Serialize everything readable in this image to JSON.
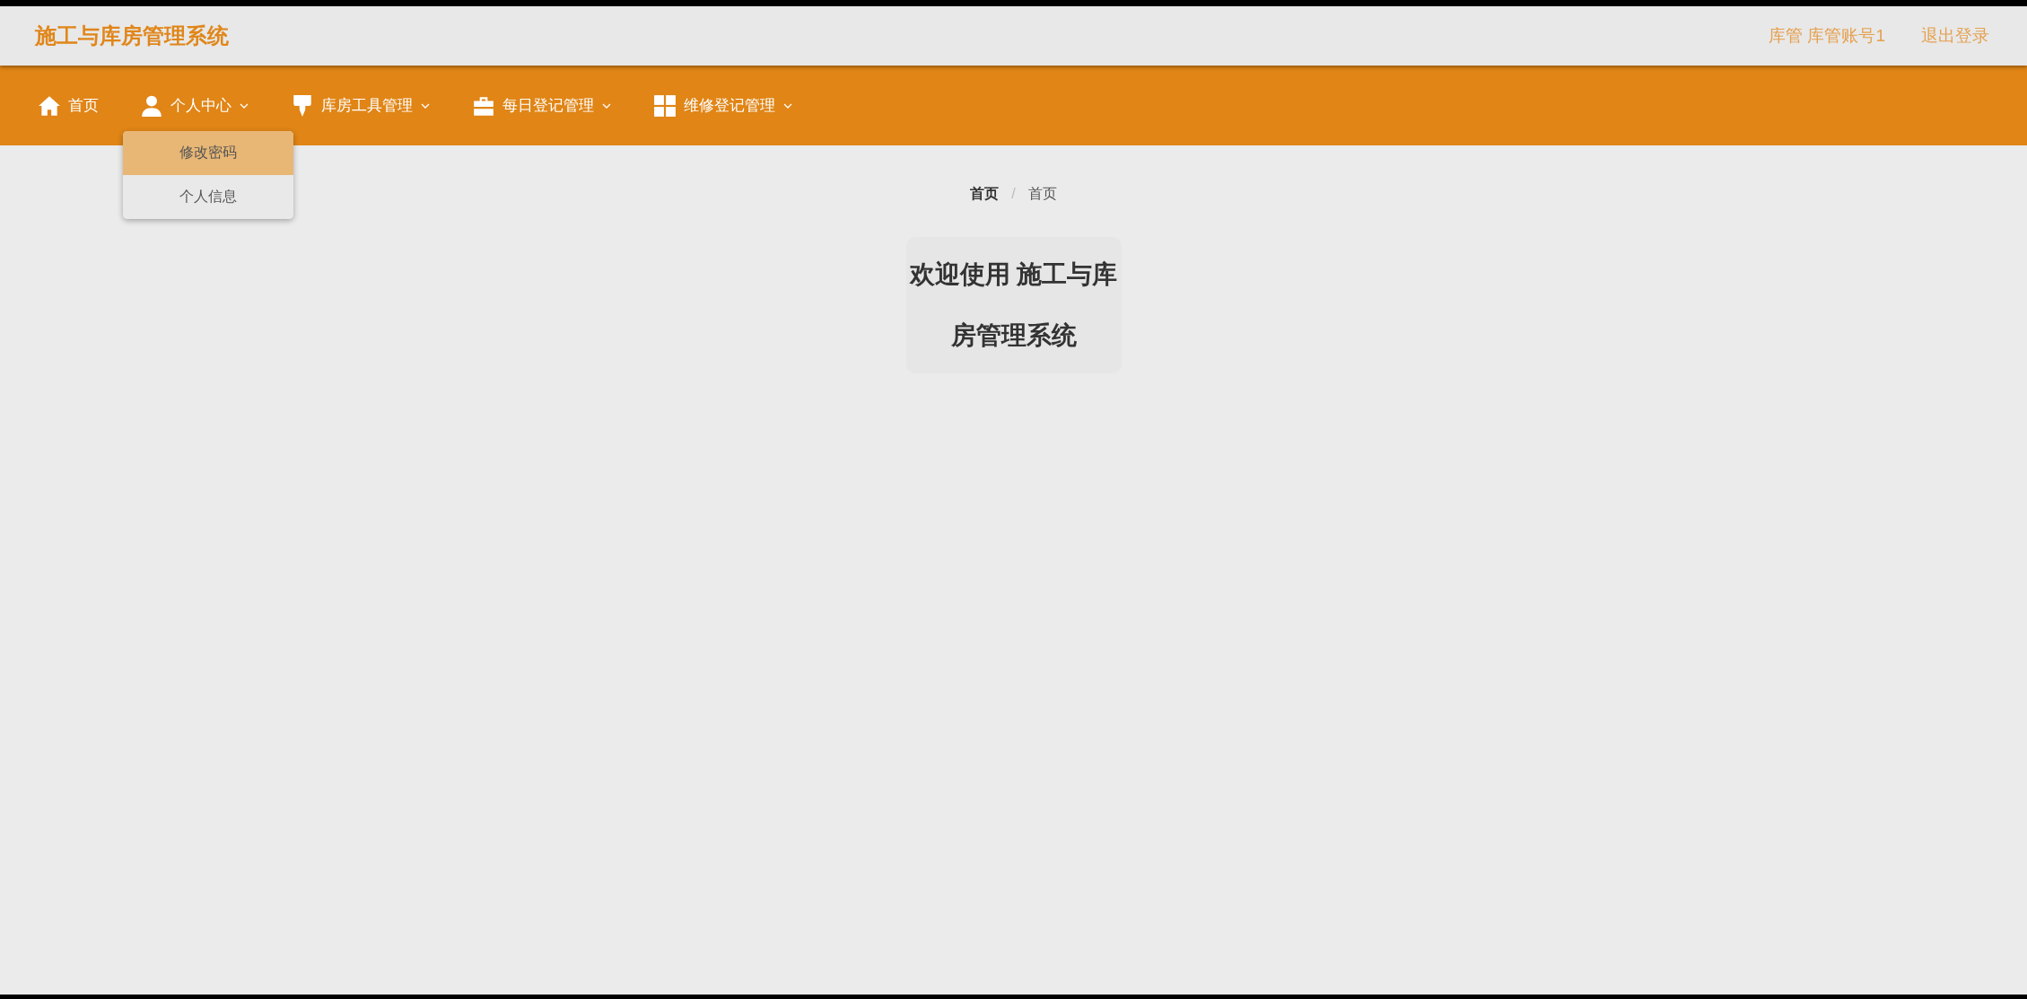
{
  "header": {
    "title": "施工与库房管理系统",
    "user": "库管 库管账号1",
    "logout": "退出登录"
  },
  "nav": [
    {
      "label": "首页",
      "kind": "home",
      "dropdown": false
    },
    {
      "label": "个人中心",
      "kind": "user",
      "dropdown": true,
      "menu": [
        {
          "label": "修改密码",
          "selected": true
        },
        {
          "label": "个人信息",
          "selected": false
        }
      ]
    },
    {
      "label": "库房工具管理",
      "kind": "brush",
      "dropdown": true
    },
    {
      "label": "每日登记管理",
      "kind": "briefcase",
      "dropdown": true
    },
    {
      "label": "维修登记管理",
      "kind": "grid",
      "dropdown": true
    }
  ],
  "breadcrumb": [
    "首页",
    "首页"
  ],
  "breadcrumb_separator": "/",
  "welcome": {
    "line1": "欢迎使用 施工与库",
    "line2": "房管理系统"
  }
}
